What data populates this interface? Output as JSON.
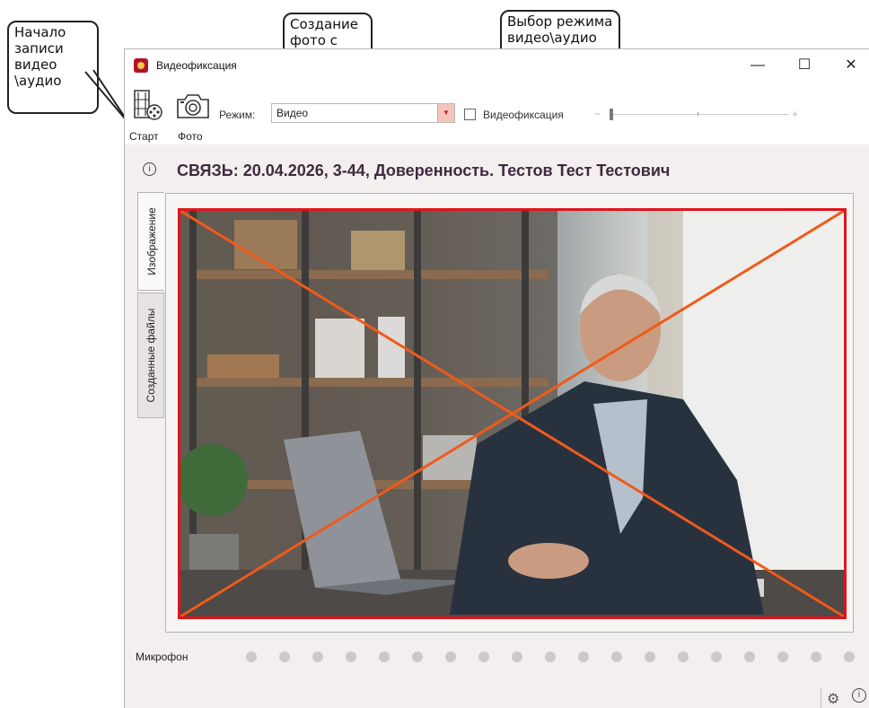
{
  "callouts": {
    "start": "Начало записи видео \\аудио",
    "photo": "Создание фото с камеры",
    "mode": "Выбор режима видео\\аудио"
  },
  "window": {
    "title": "Видеофиксация",
    "controls": {
      "minimize": "—",
      "maximize": "☐",
      "close": "✕"
    }
  },
  "toolbar": {
    "start_label": "Старт",
    "photo_label": "Фото",
    "mode_label": "Режим:",
    "mode_value": "Видео",
    "checkbox_label": "Видеофиксация",
    "slider_minus": "−",
    "slider_plus": "+"
  },
  "info": {
    "heading": "СВЯЗЬ: 20.04.2026, 3-44, Доверенность. Тестов Тест Тестович"
  },
  "tabs": [
    {
      "label": "Изображение",
      "active": true
    },
    {
      "label": "Созданные файлы",
      "active": false
    }
  ],
  "microphone": {
    "label": "Микрофон",
    "level_dots": 19,
    "level_active": 0
  },
  "icons": {
    "start": "film-record-icon",
    "photo": "camera-icon",
    "settings": "gear-icon",
    "info": "info-icon"
  },
  "colors": {
    "accent_red": "#e0141b",
    "cross_orange": "#f05a1a",
    "heading_text": "#3f2a3f"
  }
}
